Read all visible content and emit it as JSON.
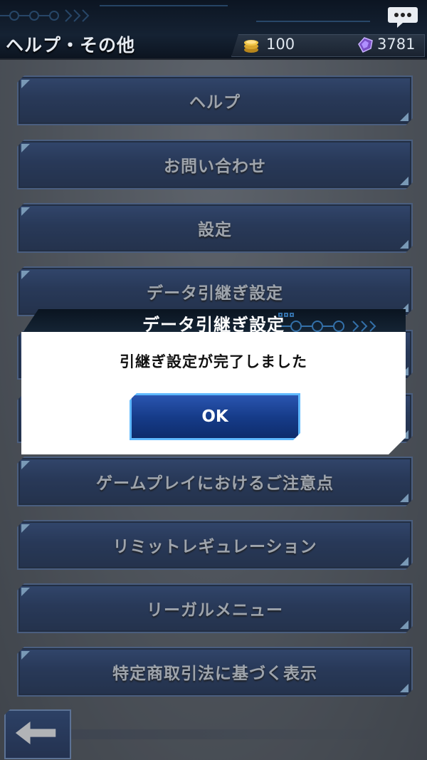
{
  "header": {
    "title": "ヘルプ・その他",
    "coins": "100",
    "gems": "3781",
    "chat_icon": "chat-bubble-icon",
    "coin_icon": "coin-stack-icon",
    "gem_icon": "gem-icon"
  },
  "menu": {
    "items": [
      {
        "label": "ヘルプ"
      },
      {
        "label": "お問い合わせ"
      },
      {
        "label": "設定"
      },
      {
        "label": "データ引継ぎ設定"
      },
      {
        "label": ""
      },
      {
        "label": ""
      },
      {
        "label": "ゲームプレイにおけるご注意点"
      },
      {
        "label": "リミットレギュレーション"
      },
      {
        "label": "リーガルメニュー"
      },
      {
        "label": "特定商取引法に基づく表示"
      }
    ]
  },
  "dialog": {
    "title": "データ引継ぎ設定",
    "message": "引継ぎ設定が完了しました",
    "ok_label": "OK"
  },
  "footer": {
    "back_icon": "arrow-left-icon"
  },
  "colors": {
    "button_blue": "#142d5e",
    "button_border": "#4f6da0",
    "accent_cyan": "#5fb9ff",
    "dialog_bg": "#ffffff"
  }
}
